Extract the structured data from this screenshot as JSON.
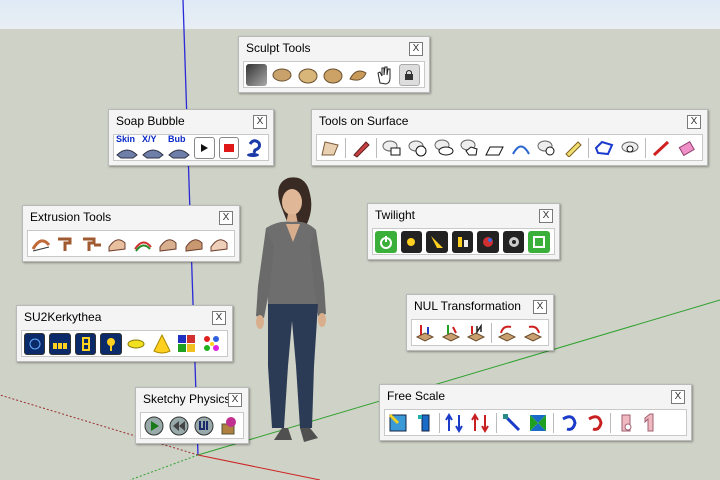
{
  "toolbars": {
    "sculpt": {
      "title": "Sculpt Tools",
      "icons": [
        "sculpt-smooth-icon",
        "sculpt-bump-icon",
        "sculpt-inflate-icon",
        "sculpt-pinch-icon",
        "sculpt-flatten-icon",
        "hand-icon",
        "lock-icon"
      ]
    },
    "soap": {
      "title": "Soap Bubble",
      "labels": {
        "skin": "Skin",
        "xy": "X/Y",
        "bub": "Bub"
      },
      "icons": [
        "skin-surface-icon",
        "xy-surface-icon",
        "bubble-surface-icon",
        "play-icon",
        "stop-icon",
        "help-icon"
      ]
    },
    "surface": {
      "title": "Tools on Surface",
      "icons": [
        "surface-select-icon",
        "surface-pen-icon",
        "surface-rectangle-icon",
        "surface-circle-icon",
        "surface-ellipse-icon",
        "surface-polygon-icon",
        "surface-parallelogram-icon",
        "surface-arc-icon",
        "surface-offset-icon",
        "surface-freehand-icon",
        "surface-contour-icon",
        "surface-void-icon",
        "surface-line-icon",
        "surface-erase-icon"
      ]
    },
    "extrusion": {
      "title": "Extrusion Tools",
      "icons": [
        "extrude-edges-icon",
        "extrude-by-face-icon",
        "extrude-by-rail-icon",
        "extrude-lathe-icon",
        "extrude-bezier-icon",
        "extrude-skin-icon",
        "extrude-mesh-icon",
        "extrude-offset-icon"
      ]
    },
    "twilight": {
      "title": "Twilight",
      "icons": [
        "power-icon",
        "sun-icon",
        "spotlight-icon",
        "settings-icon",
        "render-icon",
        "gear-icon",
        "export-icon"
      ]
    },
    "kerkythea": {
      "title": "SU2Kerkythea",
      "icons": [
        "export-scene-icon",
        "render-strip-icon",
        "film-icon",
        "tree-icon",
        "light-icon",
        "cone-icon",
        "materials-icon",
        "colors-icon"
      ]
    },
    "nul": {
      "title": "NUL Transformation",
      "icons": [
        "transform-j-icon",
        "transform-v-icon",
        "transform-n-icon",
        "rotate-icon",
        "rotate-reverse-icon"
      ]
    },
    "physics": {
      "title": "Sketchy Physics",
      "icons": [
        "physics-play-icon",
        "physics-rewind-icon",
        "physics-ui-icon",
        "physics-joint-icon"
      ]
    },
    "scale": {
      "title": "Free Scale",
      "icons": [
        "scale-box-icon",
        "scale-stretch-icon",
        "scale-up-icon",
        "scale-down-icon",
        "scale-diagonal-icon",
        "scale-taper-icon",
        "scale-twist-icon",
        "scale-bend-icon",
        "scale-flip-icon",
        "scale-one-icon"
      ]
    }
  },
  "close_glyph": "X"
}
